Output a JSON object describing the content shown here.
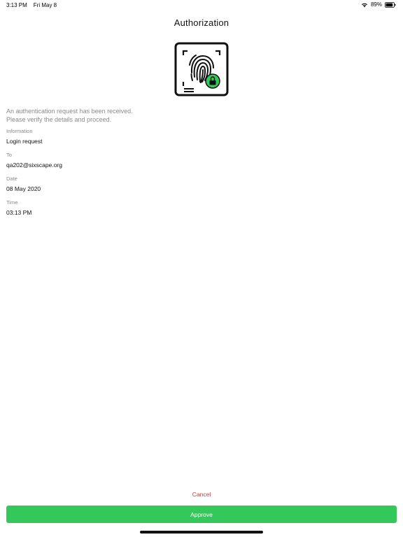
{
  "status_bar": {
    "time": "3:13 PM",
    "date": "Fri May 8",
    "battery_percent": "89%",
    "battery_level": 0.89
  },
  "header": {
    "title": "Authorization"
  },
  "illustration": {
    "icon": "fingerprint-lock-icon",
    "accent_color": "#34c759"
  },
  "message": {
    "line1": "An authentication request has been received.",
    "line2": "Please verify the details and proceed."
  },
  "details": {
    "information": {
      "label": "Information",
      "value": "Login request"
    },
    "to": {
      "label": "To",
      "value": "qa202@sixscape.org"
    },
    "date": {
      "label": "Date",
      "value": "08 May 2020"
    },
    "time": {
      "label": "Time",
      "value": "03:13 PM"
    }
  },
  "actions": {
    "cancel_label": "Cancel",
    "approve_label": "Approve",
    "cancel_color": "#e0322f",
    "approve_color": "#34c759"
  }
}
